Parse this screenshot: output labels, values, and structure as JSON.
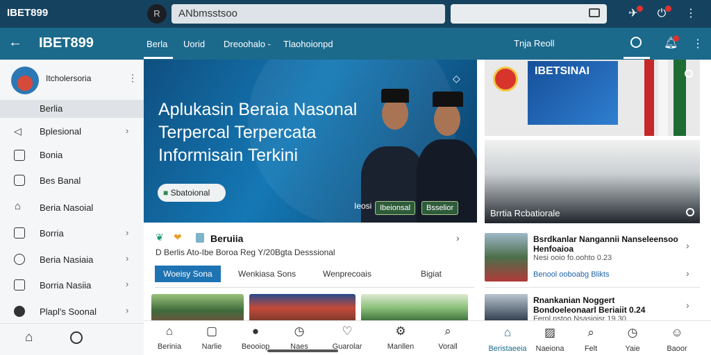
{
  "top_bar": {
    "brand": "IBET899",
    "avatar_letter": "R",
    "url": "ANbmsstsoo",
    "search_value": ""
  },
  "nav": {
    "brand": "IBET899",
    "tabs": [
      "Berla",
      "Uorid",
      "Dreoohalo -",
      "Tlaohoionpd"
    ],
    "right_tab": "Tnja Reoll"
  },
  "sidebar": {
    "profile_name": "Itcholersoria",
    "items": [
      {
        "label": "Berlia",
        "icon": "",
        "chevron": false,
        "active": true
      },
      {
        "label": "Bplesional",
        "icon": "megaphone-icon",
        "chevron": true
      },
      {
        "label": "Bonia",
        "icon": "grid-icon",
        "chevron": false
      },
      {
        "label": "Bes Banal",
        "icon": "chat-icon",
        "chevron": false
      },
      {
        "label": "Beria Nasoial",
        "icon": "tent-icon",
        "chevron": false
      },
      {
        "label": "Borria",
        "icon": "image-icon",
        "chevron": true
      },
      {
        "label": "Beria Nasiaia",
        "icon": "chat-circle-icon",
        "chevron": true
      },
      {
        "label": "Borria Nasiia",
        "icon": "doc-icon",
        "chevron": true
      },
      {
        "label": "Plapl's Soonal",
        "icon": "info-icon",
        "chevron": true
      }
    ]
  },
  "hero": {
    "title_lines": [
      "Aplukasin Beraia Nasonal",
      "Terpercal Terpercata",
      "Informisain Terkini"
    ],
    "pill": "Sbatoional",
    "caption": "Ieosi",
    "btn1": "Ibeionsal",
    "btn2": "Bsselior"
  },
  "card": {
    "title": "Beruiia",
    "subtitle": "D Berlis   Ato-Ibe Boroa Reg Y/20Bgta Desssional",
    "chips": [
      "Woeisy Sona",
      "Wenkiasa Sons",
      "Wenprecoais",
      "Bigiat"
    ]
  },
  "right": {
    "photo1_text": "IBETSINAI",
    "photo2_caption": "Brrtia Rcbatiorale",
    "news": [
      {
        "title": "Bsrdkanlar Nangannii Nanseleensoo Henfoaioa",
        "meta": "Nesi ooio  fo.oohto   0.23"
      },
      {
        "title": "Rnankanian Noggert Bondoeleonaarl Beriaiit 0.24",
        "meta": "Ferpl pstoo Nsasioisr 19.30"
      }
    ],
    "news1_meta2": "Benool ooboabg Blikts"
  },
  "bottom_left": {
    "icons": [
      "home-icon",
      "circle-icon"
    ]
  },
  "bottom_mid": {
    "items": [
      "Berinia",
      "Narlie",
      "Beooiop",
      "Naes",
      "Guarolar",
      "Manllen",
      "Vorall"
    ]
  },
  "bottom_right": {
    "items": [
      "Beristaeeia",
      "Naeiona",
      "Felt",
      "Yaie",
      "Baoor"
    ]
  },
  "colors": {
    "topbar": "#15435f",
    "navbar": "#1b6a8c",
    "accent": "#1e73b3"
  }
}
